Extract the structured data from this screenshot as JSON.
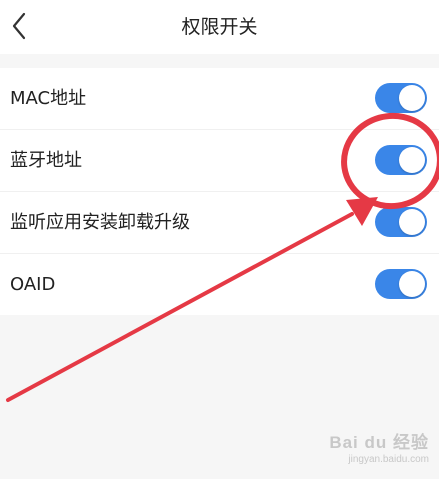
{
  "header": {
    "title": "权限开关",
    "back_icon": "chevron-left-icon"
  },
  "settings": [
    {
      "label": "MAC地址",
      "enabled": true
    },
    {
      "label": "蓝牙地址",
      "enabled": true
    },
    {
      "label": "监听应用安装卸载升级",
      "enabled": true
    },
    {
      "label": "OAID",
      "enabled": true
    }
  ],
  "colors": {
    "toggle_on": "#3a86e8",
    "annotation": "#e53945"
  },
  "watermark": {
    "brand": "Bai du 经验",
    "url": "jingyan.baidu.com"
  }
}
